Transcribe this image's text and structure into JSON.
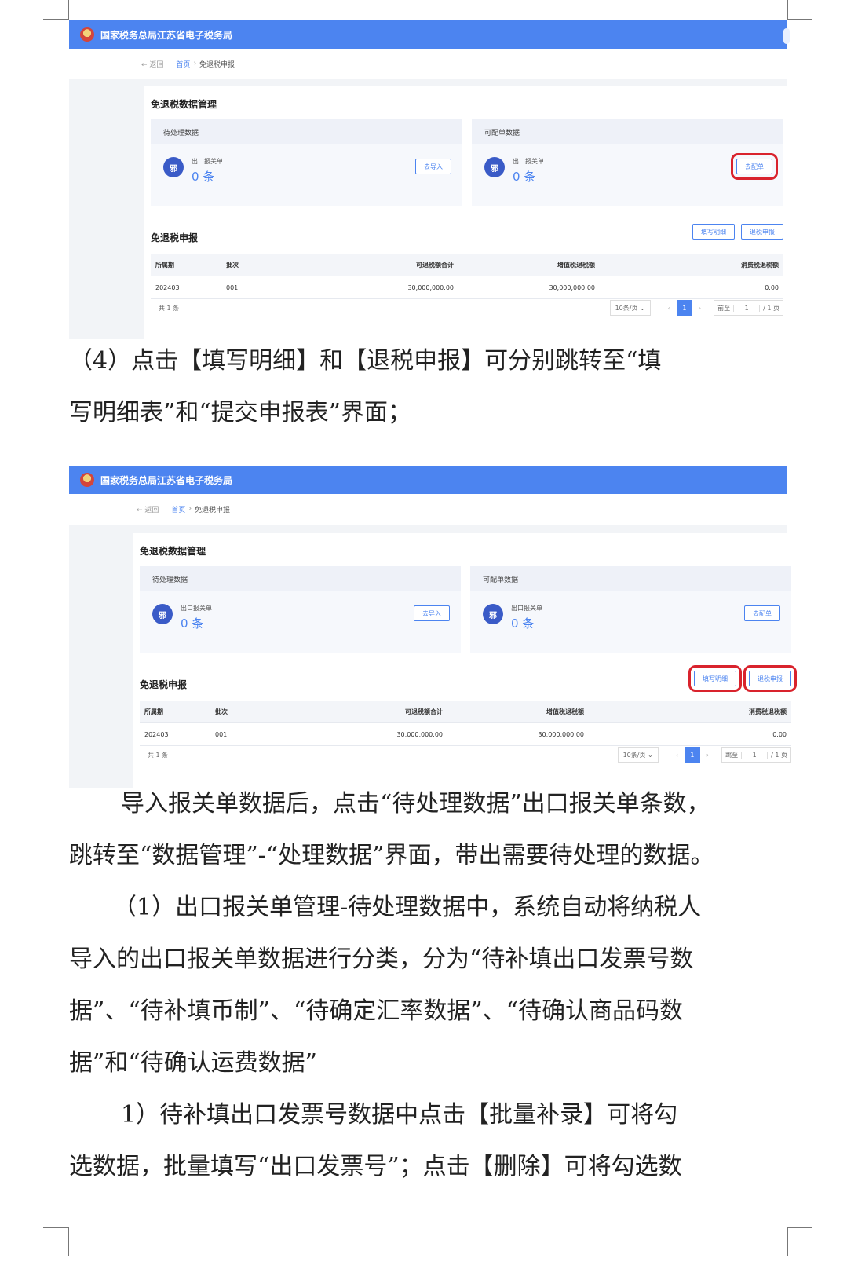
{
  "screenshot_1": {
    "header_title": "国家税务总局江苏省电子税务局",
    "breadcrumb": {
      "back": "返回",
      "home": "首页",
      "sep": "›",
      "current": "免退税申报"
    },
    "panel_title": "免退税数据管理",
    "card_pending": {
      "title": "待处理数据",
      "icon_text": "邪",
      "label": "出口报关单",
      "count": "0 条",
      "button": "去导入"
    },
    "card_matchable": {
      "title": "可配单数据",
      "icon_text": "邪",
      "label": "出口报关单",
      "count": "0 条",
      "button": "去配单"
    },
    "section_title": "免退税申报",
    "actions": {
      "fill_detail": "填写明细",
      "refund_declare": "退税申报"
    },
    "table": {
      "headers": [
        "所属期",
        "批次",
        "可退税额合计",
        "增值税退税额",
        "消费税退税额"
      ],
      "rows": [
        [
          "202403",
          "001",
          "30,000,000.00",
          "30,000,000.00",
          "0.00"
        ]
      ]
    },
    "pager": {
      "total": "共 1 条",
      "page_size": "10条/页 ⌄",
      "prev": "‹",
      "page": "1",
      "next": "›",
      "jump_label": "前至",
      "jump_value": "1",
      "pages": "/ 1 页"
    }
  },
  "paragraph_1": [
    "（4）点击【填写明细】和【退税申报】可分别跳转至“填",
    "写明细表”和“提交申报表”界面；"
  ],
  "screenshot_2": {
    "header_title": "国家税务总局江苏省电子税务局",
    "breadcrumb": {
      "back": "返回",
      "home": "首页",
      "sep": "›",
      "current": "免退税申报"
    },
    "panel_title": "免退税数据管理",
    "card_pending": {
      "title": "待处理数据",
      "icon_text": "邪",
      "label": "出口报关单",
      "count": "0 条",
      "button": "去导入"
    },
    "card_matchable": {
      "title": "可配单数据",
      "icon_text": "邪",
      "label": "出口报关单",
      "count": "0 条",
      "button": "去配单"
    },
    "section_title": "免退税申报",
    "actions": {
      "fill_detail": "填写明细",
      "refund_declare": "退税申报"
    },
    "table": {
      "headers": [
        "所属期",
        "批次",
        "可退税额合计",
        "增值税退税额",
        "消费税退税额"
      ],
      "rows": [
        [
          "202403",
          "001",
          "30,000,000.00",
          "30,000,000.00",
          "0.00"
        ]
      ]
    },
    "pager": {
      "total": "共 1 条",
      "page_size": "10条/页 ⌄",
      "prev": "‹",
      "page": "1",
      "next": "›",
      "jump_label": "跳至",
      "jump_value": "1",
      "pages": "/ 1 页"
    }
  },
  "paragraph_2": [
    "导入报关单数据后，点击“待处理数据”出口报关单条数，",
    "跳转至“数据管理”-“处理数据”界面，带出需要待处理的数据。",
    "（1）出口报关单管理-待处理数据中，系统自动将纳税人",
    "导入的出口报关单数据进行分类，分为“待补填出口发票号数",
    "据”、“待补填币制”、“待确定汇率数据”、“待确认商品码数",
    "据”和“待确认运费数据”",
    "1）待补填出口发票号数据中点击【批量补录】可将勾",
    "选数据，批量填写“出口发票号”；点击【删除】可将勾选数"
  ],
  "colors": {
    "brand_blue": "#4c84f0",
    "highlight_red": "#d9232d"
  }
}
